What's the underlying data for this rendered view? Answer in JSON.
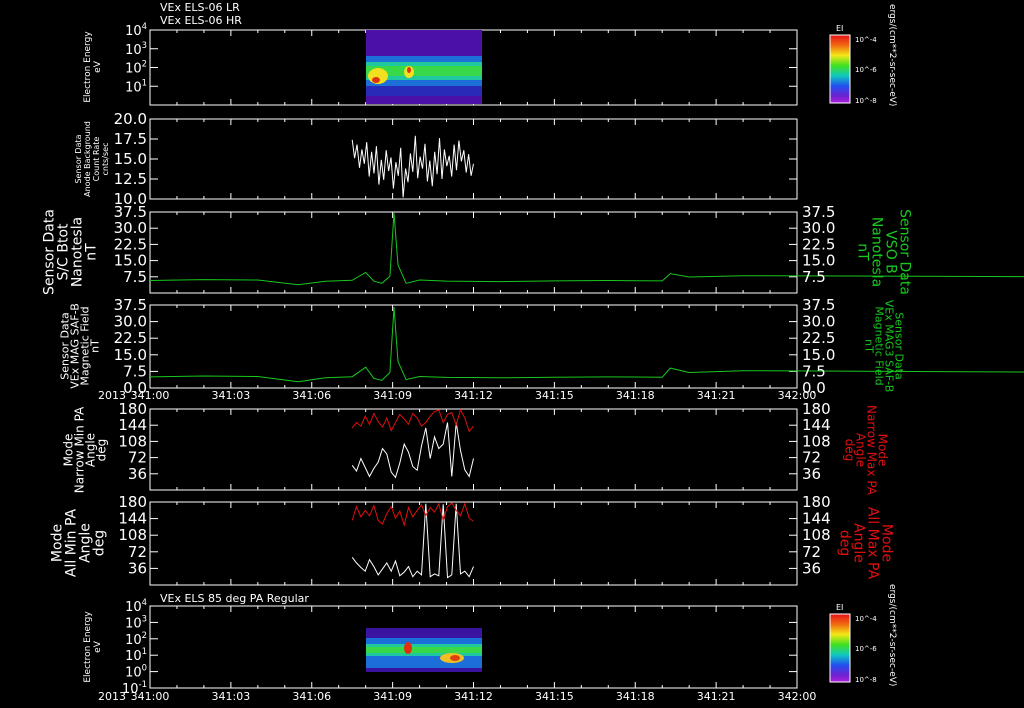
{
  "titles": {
    "top_line1": "VEx ELS-06 LR",
    "top_line2": "VEx ELS-06 HR",
    "bottom": "VEx ELS 85 deg PA Regular"
  },
  "colors": {
    "background": "#000000",
    "white_trace": "#ffffff",
    "green_trace": "#18c81e",
    "red_trace": "#e01010"
  },
  "x_axis": {
    "year_label": "2013",
    "ticks": [
      "341:00",
      "341:03",
      "341:06",
      "341:09",
      "341:12",
      "341:15",
      "341:18",
      "341:21",
      "342:00"
    ]
  },
  "chart_data": [
    {
      "type": "heatmap",
      "panel": 1,
      "ylabel": [
        "Electron Energy",
        "eV"
      ],
      "yscale": "log",
      "ylim": [
        1,
        10000
      ],
      "yticks": [
        "10^4",
        "10^3",
        "10^2",
        "10^1"
      ],
      "colorbar": {
        "title": "EI",
        "ticks": [
          "10^-4",
          "10^-6",
          "10^-8"
        ]
      },
      "colorbar_units": "ergs/(cm**2-sr-sec-eV)",
      "data_extent_x": [
        "341:07.5",
        "341:12"
      ]
    },
    {
      "type": "line",
      "panel": 2,
      "ylabel": [
        "Sensor Data",
        "Anode Background",
        "Count Rate",
        "cnts/sec"
      ],
      "ylim": [
        10,
        20
      ],
      "yticks": [
        "20.0",
        "17.5",
        "15.0",
        "12.5",
        "10.0"
      ],
      "series": [
        {
          "x_start": "341:07.5",
          "x_end": "341:12",
          "values": [
            17.4,
            15.1,
            16.8,
            13.9,
            16.2,
            14.4,
            17.1,
            12.8,
            15.9,
            13.2,
            16.6,
            11.8,
            14.9,
            12.4,
            16.1,
            13.5,
            15.2,
            11.3,
            14.6,
            12.9,
            16.4,
            10.2,
            13.8,
            12.1,
            15.7,
            13.4,
            17.9,
            12.6,
            15.3,
            13.8,
            16.9,
            12.2,
            14.8,
            11.6,
            15.9,
            13.1,
            17.6,
            12.5,
            16.2,
            14.1,
            15.4,
            12.8,
            16.8,
            13.6,
            17.3,
            14.7,
            16.1,
            13.3,
            15.6,
            12.9,
            14.4
          ]
        }
      ]
    },
    {
      "type": "line",
      "panel": 3,
      "ylabel": [
        "Sensor Data",
        "S/C Btot",
        "Nanotesla",
        "nT"
      ],
      "ylabel_right": [
        "Sensor Data",
        "VSO B",
        "Nanotesla",
        "nT"
      ],
      "ylim": [
        0,
        37.5
      ],
      "yticks": [
        "37.5",
        "30.0",
        "22.5",
        "15.0",
        "7.5"
      ],
      "series": [
        {
          "x": [
            "341:00",
            "341:02",
            "341:04",
            "341:05.5",
            "341:06.5",
            "341:07.5",
            "341:08",
            "341:08.3",
            "341:08.6",
            "341:08.9",
            "341:09.05",
            "341:09.2",
            "341:09.5",
            "341:10",
            "341:11",
            "341:13",
            "341:15",
            "341:17",
            "341:19",
            "341:19.3",
            "341:20",
            "341:22",
            "342:00"
          ],
          "values": [
            5.8,
            6.2,
            6.0,
            3.8,
            5.4,
            5.9,
            9.5,
            5.5,
            4.5,
            7.8,
            37.0,
            13.0,
            4.5,
            6.0,
            5.5,
            5.3,
            5.6,
            5.8,
            5.6,
            9.0,
            7.4,
            8.0,
            6.5
          ]
        }
      ]
    },
    {
      "type": "line",
      "panel": 4,
      "ylabel": [
        "Sensor Data",
        "VEx MAG SAF-B",
        "Magnetic Field",
        "nT"
      ],
      "ylabel_right": [
        "Sensor Data",
        "VEx MAG3 SAF-B",
        "Magnetic Field",
        "nT"
      ],
      "ylim": [
        0,
        37.5
      ],
      "yticks": [
        "37.5",
        "30.0",
        "22.5",
        "15.0",
        "7.5",
        "0.0"
      ],
      "series": [
        {
          "x": [
            "341:00",
            "341:02",
            "341:04",
            "341:05.5",
            "341:06.5",
            "341:07.5",
            "341:08",
            "341:08.3",
            "341:08.6",
            "341:08.9",
            "341:09.05",
            "341:09.2",
            "341:09.5",
            "341:10",
            "341:11",
            "341:13",
            "341:15",
            "341:17",
            "341:19",
            "341:19.3",
            "341:20",
            "341:22",
            "342:00"
          ],
          "values": [
            5.0,
            5.4,
            5.2,
            2.8,
            4.6,
            5.1,
            9.4,
            4.4,
            3.5,
            7.0,
            36.5,
            12.0,
            3.8,
            5.2,
            4.8,
            4.6,
            4.9,
            5.0,
            4.9,
            9.0,
            7.0,
            7.8,
            5.6
          ]
        }
      ]
    },
    {
      "type": "line",
      "panel": 5,
      "ylabel": [
        "Mode",
        "Narrow Min PA",
        "Angle",
        "deg"
      ],
      "ylabel_right": [
        "Mode",
        "Narrow Max PA",
        "Angle",
        "deg"
      ],
      "ylim": [
        0,
        180
      ],
      "yticks": [
        "180",
        "144",
        "108",
        "72",
        "36"
      ],
      "series": [
        {
          "name": "min",
          "values": [
            55,
            42,
            70,
            50,
            30,
            48,
            62,
            92,
            80,
            40,
            28,
            60,
            102,
            84,
            52,
            44,
            98,
            138,
            70,
            118,
            92,
            102,
            150,
            30,
            150,
            88,
            45,
            30,
            70
          ]
        },
        {
          "name": "max",
          "values": [
            138,
            150,
            142,
            164,
            146,
            170,
            152,
            140,
            160,
            132,
            150,
            168,
            158,
            146,
            170,
            160,
            142,
            150,
            164,
            174,
            178,
            150,
            168,
            172,
            144,
            178,
            160,
            130,
            142
          ]
        }
      ]
    },
    {
      "type": "line",
      "panel": 6,
      "ylabel": [
        "Mode",
        "All Min PA",
        "Angle",
        "deg"
      ],
      "ylabel_right": [
        "Mode",
        "All Max PA",
        "Angle",
        "deg"
      ],
      "ylim": [
        0,
        180
      ],
      "yticks": [
        "180",
        "144",
        "108",
        "72",
        "36"
      ],
      "series": [
        {
          "name": "min",
          "values": [
            60,
            48,
            38,
            30,
            55,
            40,
            22,
            35,
            48,
            30,
            52,
            20,
            28,
            40,
            18,
            30,
            22,
            176,
            18,
            24,
            20,
            175,
            16,
            22,
            176,
            24,
            30,
            18,
            40
          ]
        },
        {
          "name": "max",
          "values": [
            140,
            170,
            148,
            162,
            150,
            172,
            140,
            132,
            155,
            170,
            145,
            160,
            130,
            168,
            148,
            162,
            174,
            150,
            168,
            158,
            176,
            140,
            170,
            178,
            162,
            150,
            176,
            145,
            138
          ]
        }
      ]
    },
    {
      "type": "heatmap",
      "panel": 7,
      "ylabel": [
        "Electron Energy",
        "eV"
      ],
      "yscale": "log",
      "ylim": [
        0.1,
        10000
      ],
      "yticks": [
        "10^4",
        "10^3",
        "10^2",
        "10^1",
        "10^0",
        "10^-1"
      ],
      "colorbar": {
        "title": "EI",
        "ticks": [
          "10^-4",
          "10^-6",
          "10^-8"
        ]
      },
      "colorbar_units": "ergs/(cm**2-sr-sec-eV)",
      "data_extent_x": [
        "341:07.5",
        "341:12"
      ]
    }
  ]
}
